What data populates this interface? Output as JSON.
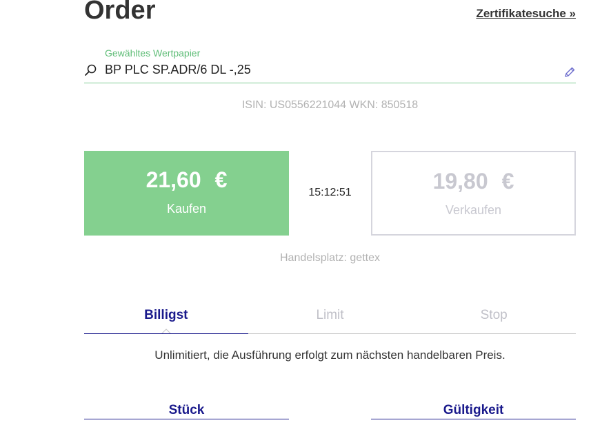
{
  "header": {
    "title": "Order",
    "certificate_search_link": "Zertifikatesuche »"
  },
  "security": {
    "label": "Gewähltes Wertpapier",
    "value": "BP PLC SP.ADR/6 DL -,25",
    "identifiers": "ISIN: US0556221044 WKN: 850518"
  },
  "quote": {
    "buy_price": "21,60",
    "buy_currency": "€",
    "buy_label": "Kaufen",
    "time": "15:12:51",
    "sell_price": "19,80",
    "sell_currency": "€",
    "sell_label": "Verkaufen",
    "venue": "Handelsplatz: gettex"
  },
  "order_types": {
    "tabs": [
      {
        "label": "Billigst",
        "active": true
      },
      {
        "label": "Limit",
        "active": false
      },
      {
        "label": "Stop",
        "active": false
      }
    ],
    "description": "Unlimitiert, die Ausführung erfolgt zum nächsten handelbaren Preis."
  },
  "fields": {
    "quantity_label": "Stück",
    "validity_label": "Gültigkeit"
  },
  "colors": {
    "buy_green": "#84d08f",
    "accent_navy": "#1a1a8c",
    "field_line_green": "#7ecb94"
  },
  "icons": {
    "search": "search-icon",
    "edit": "pencil-icon"
  }
}
